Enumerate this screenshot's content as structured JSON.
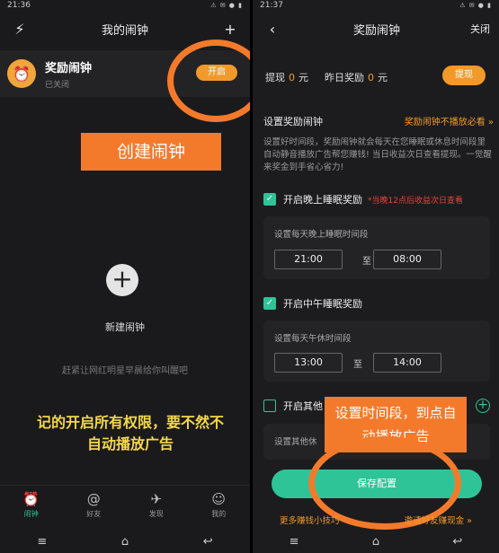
{
  "left": {
    "status": {
      "time": "21:36",
      "icons": "⚠ ✉ ● ▮"
    },
    "header": {
      "icon": "⚡",
      "title": "我的闹钟",
      "add": "+"
    },
    "alarm": {
      "name": "奖励闹钟",
      "status": "已关闭",
      "button": "开启"
    },
    "annotation": "创建闹钟",
    "empty": {
      "new_label": "新建闹钟",
      "hint": "赶紧让网红明星早晨给你叫醒吧"
    },
    "note": "记的开启所有权限，要不然不自动播放广告",
    "tabs": [
      {
        "icon": "⏰",
        "label": "闹钟"
      },
      {
        "icon": "@",
        "label": "好友"
      },
      {
        "icon": "✈",
        "label": "发现"
      },
      {
        "icon": "☺",
        "label": "我的"
      }
    ]
  },
  "right": {
    "status": {
      "time": "21:37",
      "icons": "⚠ ✉ ● ▮"
    },
    "header": {
      "back": "‹",
      "title": "奖励闹钟",
      "close": "关闭"
    },
    "earn": {
      "withdraw_label": "提现",
      "withdraw_value": "0",
      "unit": "元",
      "yesterday_label": "昨日奖励",
      "yesterday_value": "0",
      "button": "提现"
    },
    "section_title": "设置奖励闹钟",
    "section_link": "奖励闹钟不播放必看 »",
    "description": "设置好时间段，奖励闹钟就会每天在您睡眠或休息时间段里自动静音播放广告帮您赚钱! 当日收益次日查看提现。一觉醒来奖金到手省心省力!",
    "night": {
      "label": "开启晚上睡眠奖励",
      "note": "*当晚12点后收益次日查看",
      "box_label": "设置每天晚上睡眠时间段",
      "start": "21:00",
      "sep": "至",
      "end": "08:00"
    },
    "noon": {
      "label": "开启中午睡眠奖励",
      "box_label": "设置每天午休时间段",
      "start": "13:00",
      "sep": "至",
      "end": "14:00"
    },
    "other": {
      "label": "开启其他",
      "box_label": "设置其他休"
    },
    "annotation": "设置时间段，到点自动播放广告",
    "save": "保存配置",
    "links": {
      "left": "更多赚钱小技巧",
      "right": "邀请好友赚现金 »"
    }
  },
  "nav": {
    "menu": "≡",
    "home": "⌂",
    "back": "↩"
  }
}
